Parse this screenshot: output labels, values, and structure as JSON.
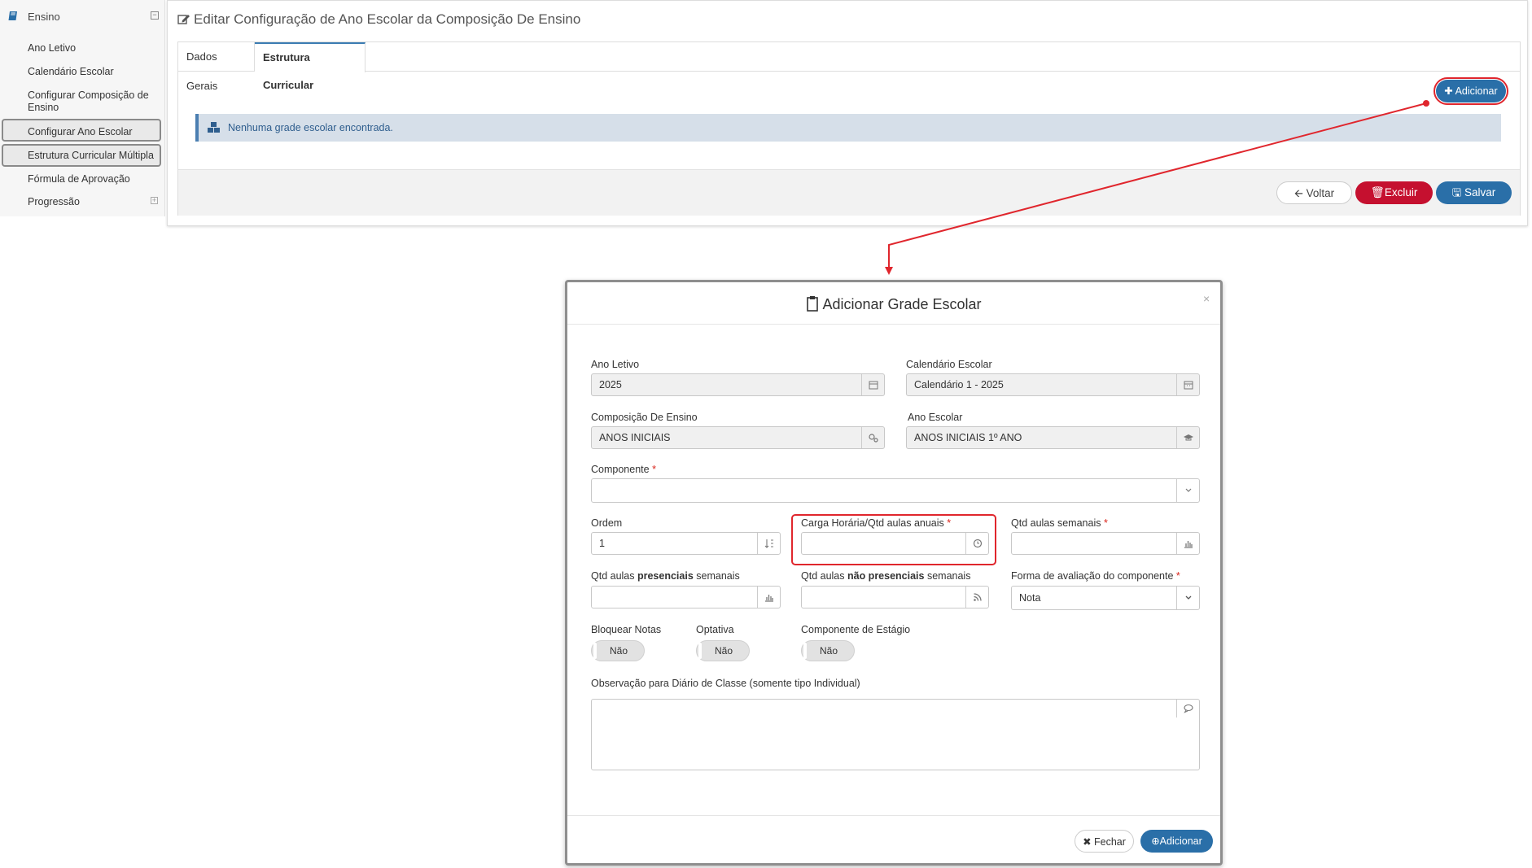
{
  "sidebar": {
    "section_title": "Ensino",
    "items": [
      {
        "label": "Ano Letivo"
      },
      {
        "label": "Calendário Escolar"
      },
      {
        "label": "Configurar Composição de Ensino"
      },
      {
        "label": "Configurar Ano Escolar"
      },
      {
        "label": "Estrutura Curricular Múltipla"
      },
      {
        "label": "Fórmula de Aprovação"
      },
      {
        "label": "Progressão"
      }
    ]
  },
  "page": {
    "title": "Editar Configuração de Ano Escolar da Composição De Ensino",
    "tabs": [
      {
        "label": "Dados Gerais"
      },
      {
        "label": "Estrutura Curricular"
      }
    ],
    "add_button": "Adicionar",
    "empty_message": "Nenhuma grade escolar encontrada.",
    "actions": {
      "back": "Voltar",
      "delete": "Excluir",
      "save": "Salvar"
    }
  },
  "modal": {
    "title": "Adicionar Grade Escolar",
    "close_symbol": "×",
    "fields": {
      "ano_letivo": {
        "label": "Ano Letivo",
        "value": "2025"
      },
      "calendario": {
        "label": "Calendário Escolar",
        "value": "Calendário 1 - 2025"
      },
      "composicao": {
        "label": "Composição De Ensino",
        "value": "ANOS INICIAIS"
      },
      "ano_escolar": {
        "label": "Ano Escolar",
        "value": "ANOS INICIAIS 1º ANO"
      },
      "componente": {
        "label": "Componente",
        "value": ""
      },
      "ordem": {
        "label": "Ordem",
        "value": "1"
      },
      "carga_horaria": {
        "label": "Carga Horária/Qtd aulas anuais",
        "value": ""
      },
      "qtd_semanais": {
        "label": "Qtd aulas semanais",
        "value": ""
      },
      "presenciais": {
        "label_pre": "Qtd aulas ",
        "label_bold": "presenciais",
        "label_post": " semanais",
        "value": ""
      },
      "nao_presenciais": {
        "label_pre": "Qtd aulas ",
        "label_bold": "não presenciais",
        "label_post": " semanais",
        "value": ""
      },
      "forma_avaliacao": {
        "label": "Forma de avaliação do componente",
        "value": "Nota"
      },
      "bloquear_notas": {
        "label": "Bloquear Notas",
        "value": "Não"
      },
      "optativa": {
        "label": "Optativa",
        "value": "Não"
      },
      "estagio": {
        "label": "Componente de Estágio",
        "value": "Não"
      },
      "observacao": {
        "label": "Observação para Diário de Classe (somente tipo Individual)",
        "value": ""
      }
    },
    "required_mark": "*",
    "buttons": {
      "close": "Fechar",
      "add": "Adicionar"
    }
  },
  "colors": {
    "primary": "#2a6fa8",
    "danger": "#c5102f",
    "annotation_red": "#e0262d",
    "alert_bg": "#d6dfe9"
  }
}
